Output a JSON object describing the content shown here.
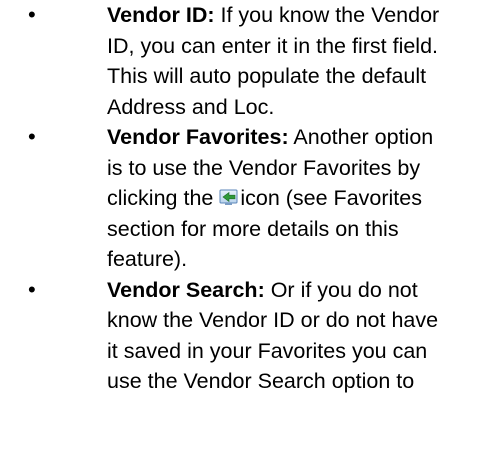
{
  "bullets": [
    {
      "term": "Vendor ID:",
      "text_lines": [
        " If you know the Vendor",
        "ID, you can enter it in the first field.",
        "This will auto populate the default",
        "Address and Loc."
      ]
    },
    {
      "term": "Vendor Favorites:",
      "text_before_icon_lines": [
        " Another option",
        "is to use the Vendor Favorites by",
        "clicking the "
      ],
      "icon_name": "favorites-arrow-icon",
      "text_after_icon_lines": [
        "icon (see Favorites",
        "section for more details on this",
        "feature)."
      ]
    },
    {
      "term": "Vendor Search:",
      "text_lines": [
        " Or if you do not",
        "know the Vendor ID or do not have",
        "it saved in your Favorites you can",
        "use the Vendor Search option to"
      ]
    }
  ],
  "bullet_symbol": "•"
}
